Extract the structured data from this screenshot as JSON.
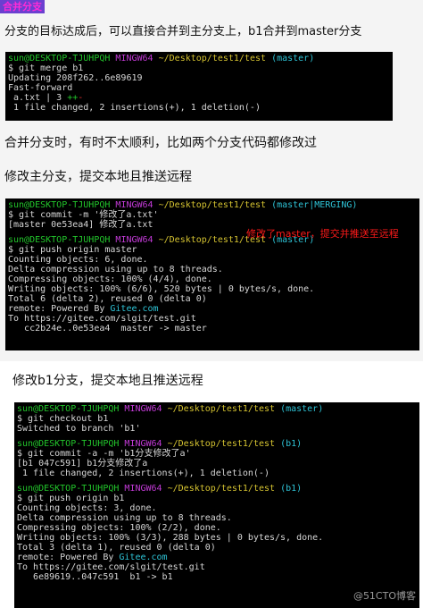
{
  "heading": "合并分支",
  "intro": "分支的目标达成后，可以直接合并到主分支上，b1合并到master分支",
  "para_conflict": "合并分支时，有时不太顺利，比如两个分支代码都修改过",
  "para_modify_master": "修改主分支，提交本地且推送远程",
  "para_modify_b1": "修改b1分支，提交本地且推送远程",
  "annotation": "修改了master，提交并推送至远程",
  "watermark": "@51CTO博客",
  "term1": {
    "prompt_user": "sun@DESKTOP-TJUHPQH",
    "prompt_app": "MINGW64",
    "prompt_path": "~/Desktop/test1/test",
    "prompt_branch": "(master)",
    "lines": [
      "$ git merge b1",
      "Updating 208f262..6e89619",
      "Fast-forward",
      " a.txt | 3 ",
      " 1 file changed, 2 insertions(+), 1 deletion(-)"
    ],
    "diff_plus": "++",
    "diff_minus": "-"
  },
  "term2": {
    "prompt_user": "sun@DESKTOP-TJUHPQH",
    "prompt_app": "MINGW64",
    "prompt_path": "~/Desktop/test1/test",
    "prompt_branch_1": "(master|MERGING)",
    "prompt_branch_2": "(master)",
    "lines_a": [
      "$ git commit -m '修改了a.txt'",
      "[master 0e53ea4] 修改了a.txt"
    ],
    "lines_b": [
      "$ git push origin master",
      "Counting objects: 6, done.",
      "Delta compression using up to 8 threads.",
      "Compressing objects: 100% (4/4), done.",
      "Writing objects: 100% (6/6), 520 bytes | 0 bytes/s, done.",
      "Total 6 (delta 2), reused 0 (delta 0)",
      "remote: Powered By ",
      "To https://gitee.com/slgit/test.git",
      "   cc2b24e..0e53ea4  master -> master"
    ],
    "gitee": "Gitee.com"
  },
  "term3": {
    "prompt_user": "sun@DESKTOP-TJUHPQH",
    "prompt_app": "MINGW64",
    "prompt_path": "~/Desktop/test1/test",
    "prompt_branch_1": "(master)",
    "prompt_branch_2": "(b1)",
    "lines_a": [
      "$ git checkout b1",
      "Switched to branch 'b1'"
    ],
    "lines_b": [
      "$ git commit -a -m 'b1分支修改了a'",
      "[b1 047c591] b1分支修改了a",
      " 1 file changed, 2 insertions(+), 1 deletion(-)"
    ],
    "lines_c": [
      "$ git push origin b1",
      "Counting objects: 3, done.",
      "Delta compression using up to 8 threads.",
      "Compressing objects: 100% (2/2), done.",
      "Writing objects: 100% (3/3), 288 bytes | 0 bytes/s, done.",
      "Total 3 (delta 1), reused 0 (delta 0)",
      "remote: Powered By ",
      "To https://gitee.com/slgit/test.git",
      "   6e89619..047c591  b1 -> b1"
    ],
    "gitee": "Gitee.com"
  }
}
